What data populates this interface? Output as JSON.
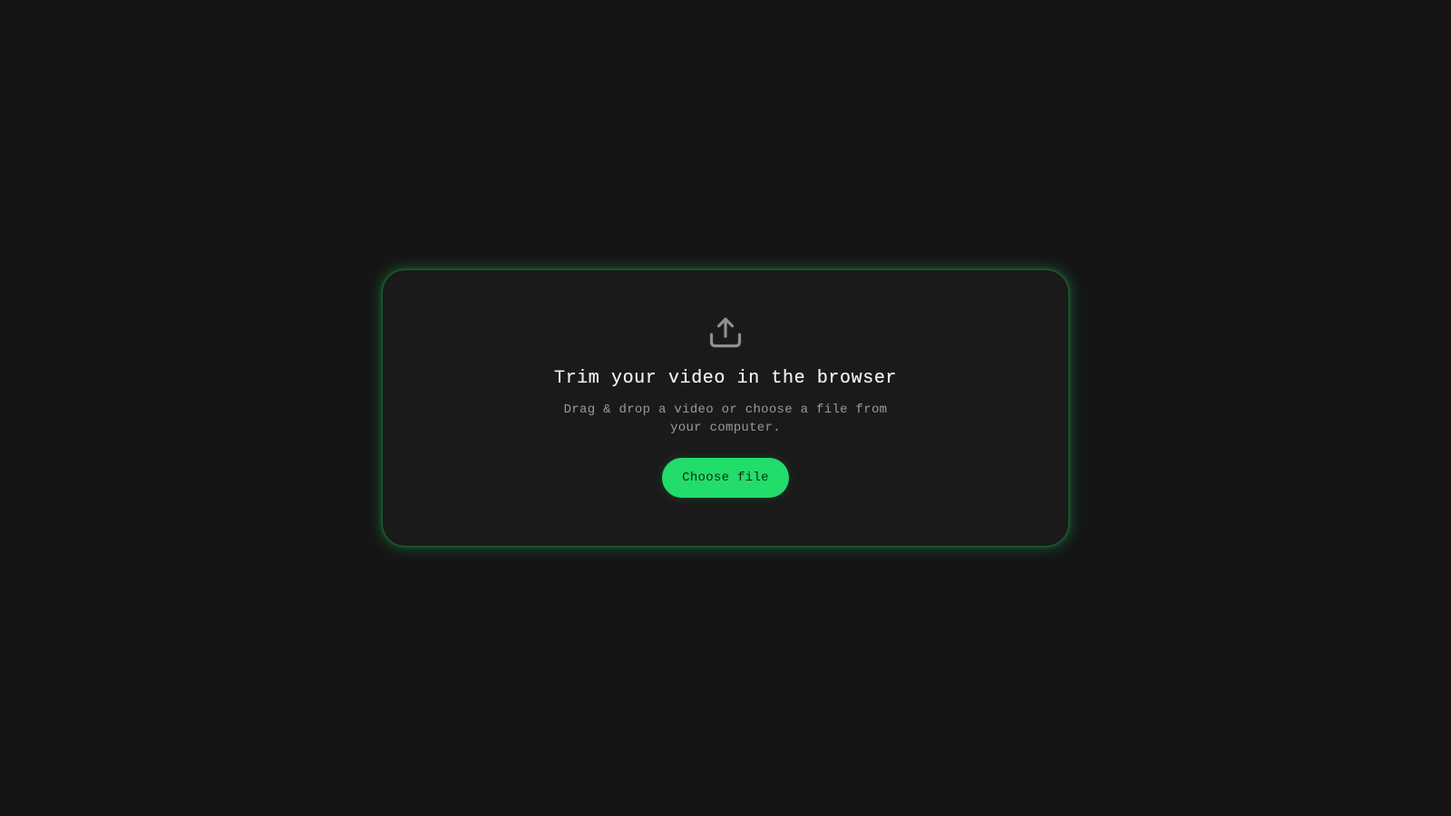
{
  "upload_card": {
    "icon": "upload-icon",
    "title": "Trim your video in the browser",
    "subtitle": "Drag & drop a video or choose a file from your computer.",
    "button_label": "Choose file"
  },
  "colors": {
    "background": "#151515",
    "card_background": "#1a1a1a",
    "accent": "#22dd6a",
    "card_border_glow": "#22c55e",
    "title_text": "#f2f2f2",
    "subtitle_text": "#9a9a9a",
    "icon": "#8f8f8f"
  }
}
